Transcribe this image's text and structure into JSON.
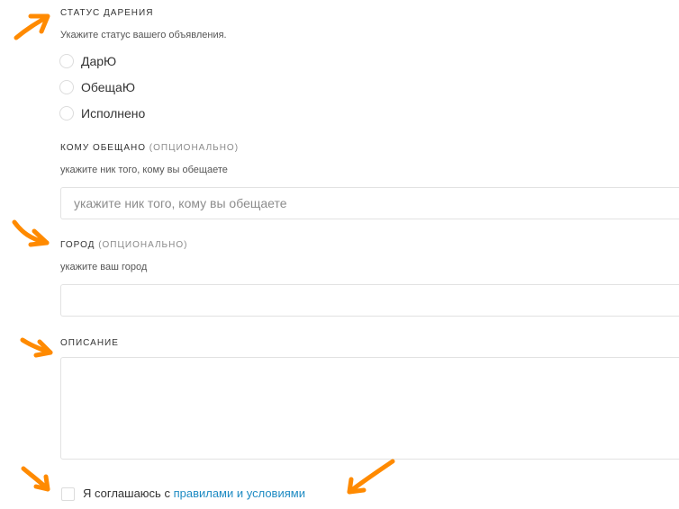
{
  "status": {
    "title": "СТАТУС ДАРЕНИЯ",
    "hint": "Укажите статус вашего объявления.",
    "options": [
      "ДарЮ",
      "ОбещаЮ",
      "Исполнено"
    ]
  },
  "recipient": {
    "title": "КОМУ ОБЕЩАНО",
    "optional": "(ОПЦИОНАЛЬНО)",
    "hint": "укажите ник того, кому вы обещаете",
    "placeholder": "укажите ник того, кому вы обещаете",
    "value": ""
  },
  "city": {
    "title": "ГОРОД",
    "optional": "(ОПЦИОНАЛЬНО)",
    "hint": "укажите ваш город",
    "value": ""
  },
  "description": {
    "title": "ОПИСАНИЕ",
    "value": ""
  },
  "agreement": {
    "text": "Я соглашаюсь с",
    "link": "правилами и условиями",
    "checked": false
  },
  "annotation_color": "#ff8a00"
}
